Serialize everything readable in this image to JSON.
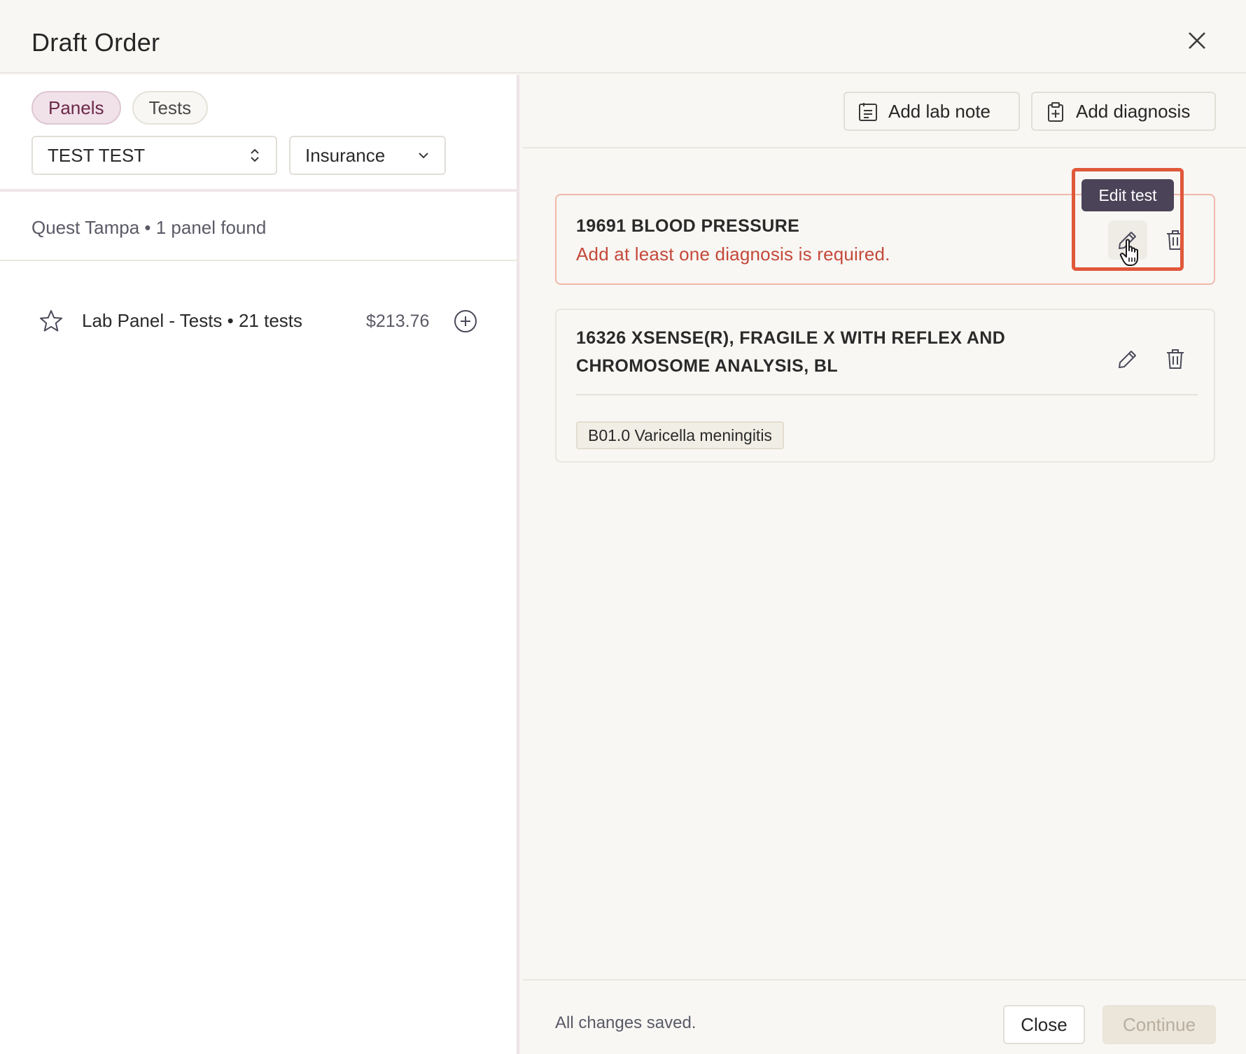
{
  "header": {
    "title": "Draft Order"
  },
  "left": {
    "tabs": [
      {
        "label": "Panels",
        "active": true
      },
      {
        "label": "Tests",
        "active": false
      }
    ],
    "patient_select": {
      "value": "TEST TEST"
    },
    "billing_select": {
      "value": "Insurance"
    },
    "lab_summary": "Quest Tampa • 1 panel found",
    "panels": [
      {
        "label": "Lab Panel - Tests • 21 tests",
        "price": "$213.76",
        "icon": "star-icon"
      }
    ]
  },
  "toolbar": {
    "add_lab_note": "Add lab note",
    "add_diagnosis": "Add diagnosis"
  },
  "tests": [
    {
      "title": "19691 BLOOD PRESSURE",
      "error": "Add at least one diagnosis is required.",
      "diagnoses": []
    },
    {
      "title_line1": "16326 XSENSE(R), FRAGILE X WITH REFLEX AND",
      "title_line2": "CHROMOSOME ANALYSIS, BL",
      "diagnoses": [
        "B01.0 Varicella meningitis"
      ]
    }
  ],
  "tooltip": {
    "text": "Edit test"
  },
  "footer": {
    "status": "All changes saved.",
    "close_label": "Close",
    "continue_label": "Continue"
  },
  "colors": {
    "accent": "#6b2a4a",
    "error": "#c4493a",
    "highlight": "#e0583a",
    "tooltip_bg": "#4b4358"
  }
}
